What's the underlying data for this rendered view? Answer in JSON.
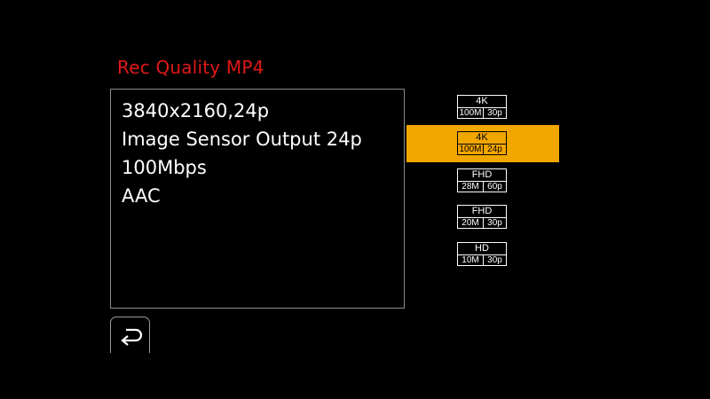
{
  "title": "Rec Quality MP4",
  "info": {
    "resolution": "3840x2160,24p",
    "sensor_output": "Image Sensor Output 24p",
    "bitrate": "100Mbps",
    "audio": "AAC"
  },
  "back_icon": "return-arrow-icon",
  "options": [
    {
      "res": "4K",
      "rate": "100M",
      "fps": "30p",
      "selected": false
    },
    {
      "res": "4K",
      "rate": "100M",
      "fps": "24p",
      "selected": true
    },
    {
      "res": "FHD",
      "rate": "28M",
      "fps": "60p",
      "selected": false
    },
    {
      "res": "FHD",
      "rate": "20M",
      "fps": "30p",
      "selected": false
    },
    {
      "res": "HD",
      "rate": "10M",
      "fps": "30p",
      "selected": false
    }
  ],
  "colors": {
    "title": "#e01818",
    "highlight": "#f2a600",
    "background": "#000000"
  }
}
